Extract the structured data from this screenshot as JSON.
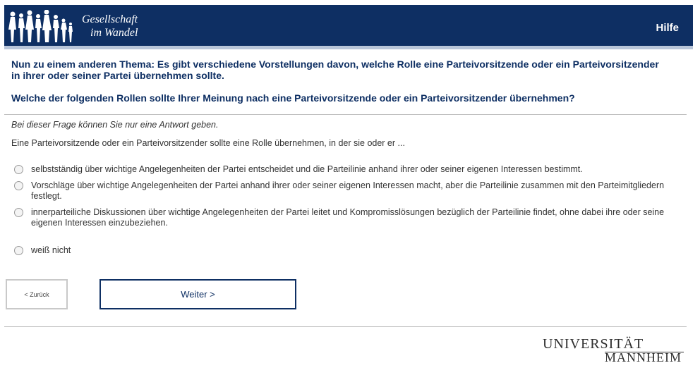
{
  "header": {
    "title_line1": "Gesellschaft",
    "title_line2": "im Wandel",
    "help_label": "Hilfe"
  },
  "question": {
    "intro": "Nun zu einem anderen Thema: Es gibt verschiedene Vorstellungen davon, welche Rolle eine Parteivorsitzende oder ein Parteivorsitzender in ihrer oder seiner Partei übernehmen sollte.",
    "text": "Welche der folgenden Rollen sollte Ihrer Meinung nach eine Parteivorsitzende oder ein Parteivorsitzender übernehmen?",
    "hint": "Bei dieser Frage können Sie nur eine Antwort geben.",
    "stem": "Eine Parteivorsitzende oder ein Parteivorsitzender sollte eine Rolle übernehmen, in der sie oder er ...",
    "options": [
      "selbstständig über wichtige Angelegenheiten der Partei entscheidet und die Parteilinie anhand ihrer oder seiner eigenen Interessen bestimmt.",
      "Vorschläge über wichtige Angelegenheiten der Partei anhand ihrer oder seiner eigenen Interessen macht, aber die Parteilinie zusammen mit den Parteimitgliedern festlegt.",
      "innerparteiliche Diskussionen über wichtige Angelegenheiten der Partei leitet und Kompromisslösungen bezüglich der Parteilinie findet, ohne dabei ihre oder seine eigenen Interessen einzubeziehen.",
      "weiß nicht"
    ]
  },
  "nav": {
    "back_label": "< Zurück",
    "next_label": "Weiter >"
  },
  "footer": {
    "uni_line1": "UNIVERSITÄT",
    "uni_line2": "MANNHEIM"
  }
}
